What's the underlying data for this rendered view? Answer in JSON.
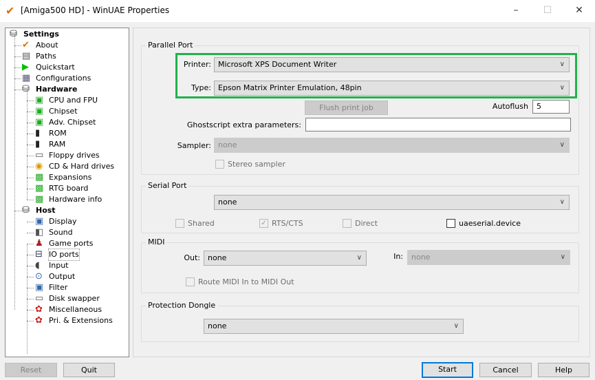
{
  "window": {
    "title": "[Amiga500 HD] - WinUAE Properties",
    "app_icon": "checkmark-icon",
    "minimize": "–",
    "maximize": "☐",
    "close": "✕"
  },
  "tree": [
    {
      "label": "Settings",
      "level": 0,
      "bold": true,
      "icon": "disk-stack-icon"
    },
    {
      "label": "About",
      "level": 1,
      "icon": "checkmark-icon"
    },
    {
      "label": "Paths",
      "level": 1,
      "icon": "folder-paths-icon"
    },
    {
      "label": "Quickstart",
      "level": 1,
      "icon": "play-icon"
    },
    {
      "label": "Configurations",
      "level": 1,
      "icon": "config-list-icon"
    },
    {
      "label": "Hardware",
      "level": 1,
      "bold": true,
      "icon": "disk-stack-icon"
    },
    {
      "label": "CPU and FPU",
      "level": 2,
      "icon": "chip-icon"
    },
    {
      "label": "Chipset",
      "level": 2,
      "icon": "chip-icon"
    },
    {
      "label": "Adv. Chipset",
      "level": 2,
      "icon": "chip-icon"
    },
    {
      "label": "ROM",
      "level": 2,
      "icon": "memory-icon"
    },
    {
      "label": "RAM",
      "level": 2,
      "icon": "memory-icon"
    },
    {
      "label": "Floppy drives",
      "level": 2,
      "icon": "floppy-drive-icon"
    },
    {
      "label": "CD & Hard drives",
      "level": 2,
      "icon": "hard-drive-icon"
    },
    {
      "label": "Expansions",
      "level": 2,
      "icon": "expansion-card-icon"
    },
    {
      "label": "RTG board",
      "level": 2,
      "icon": "expansion-card-icon"
    },
    {
      "label": "Hardware info",
      "level": 2,
      "icon": "expansion-card-icon"
    },
    {
      "label": "Host",
      "level": 1,
      "bold": true,
      "icon": "disk-stack-icon"
    },
    {
      "label": "Display",
      "level": 2,
      "icon": "monitor-icon"
    },
    {
      "label": "Sound",
      "level": 2,
      "icon": "speaker-icon"
    },
    {
      "label": "Game ports",
      "level": 2,
      "icon": "joystick-icon"
    },
    {
      "label": "IO ports",
      "level": 2,
      "icon": "io-port-icon",
      "selected": true
    },
    {
      "label": "Input",
      "level": 2,
      "icon": "mouse-icon"
    },
    {
      "label": "Output",
      "level": 2,
      "icon": "output-icon"
    },
    {
      "label": "Filter",
      "level": 2,
      "icon": "monitor-icon"
    },
    {
      "label": "Disk swapper",
      "level": 2,
      "icon": "floppy-drive-icon"
    },
    {
      "label": "Miscellaneous",
      "level": 2,
      "icon": "misc-icon"
    },
    {
      "label": "Pri. & Extensions",
      "level": 2,
      "icon": "misc-icon"
    }
  ],
  "parallel": {
    "title": "Parallel Port",
    "printer_label": "Printer:",
    "printer_value": "Microsoft XPS Document Writer",
    "type_label": "Type:",
    "type_value": "Epson Matrix Printer Emulation, 48pin",
    "flush_label": "Flush print job",
    "autoflush_label": "Autoflush",
    "autoflush_value": "5",
    "ghostscript_label": "Ghostscript extra parameters:",
    "ghostscript_value": "",
    "sampler_label": "Sampler:",
    "sampler_value": "none",
    "stereo_label": "Stereo sampler"
  },
  "serial": {
    "title": "Serial Port",
    "port_value": "none",
    "shared_label": "Shared",
    "rtscts_label": "RTS/CTS",
    "direct_label": "Direct",
    "uaeserial_label": "uaeserial.device"
  },
  "midi": {
    "title": "MIDI",
    "out_label": "Out:",
    "out_value": "none",
    "in_label": "In:",
    "in_value": "none",
    "route_label": "Route MIDI In to MIDI Out"
  },
  "dongle": {
    "title": "Protection Dongle",
    "value": "none"
  },
  "buttons": {
    "reset": "Reset",
    "quit": "Quit",
    "start": "Start",
    "cancel": "Cancel",
    "help": "Help"
  },
  "colors": {
    "highlight": "#22b14c",
    "default_button": "#0078d7"
  }
}
